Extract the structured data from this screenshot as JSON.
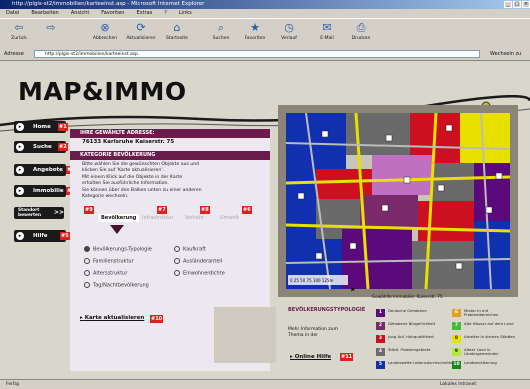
{
  "window": {
    "title": "http://plgis-st2/immobilien/karteeinst.asp - Microsoft Internet Explorer"
  },
  "menu": [
    "Datei",
    "Bearbeiten",
    "Ansicht",
    "Favoriten",
    "Extras",
    "?",
    "Links"
  ],
  "toolbar": [
    {
      "label": "Zurück",
      "icon": "back-icon"
    },
    {
      "label": "",
      "icon": "forward-icon"
    },
    {
      "label": "Abbrechen",
      "icon": "stop-icon"
    },
    {
      "label": "Aktualisieren",
      "icon": "refresh-icon"
    },
    {
      "label": "Startseite",
      "icon": "home-icon"
    },
    {
      "label": "Suchen",
      "icon": "search-icon"
    },
    {
      "label": "Favoriten",
      "icon": "favorites-icon"
    },
    {
      "label": "Verlauf",
      "icon": "history-icon"
    },
    {
      "label": "E-Mail",
      "icon": "mail-icon"
    },
    {
      "label": "Drucken",
      "icon": "print-icon"
    }
  ],
  "address": {
    "label": "Adresse",
    "url": "http://plgis-st2/immobilien/karteeinst.asp",
    "go": "Wechseln zu"
  },
  "logo": "MAP&IMMO",
  "nav": [
    {
      "label": "Home",
      "num": "#1"
    },
    {
      "label": "Suche",
      "num": "#2"
    },
    {
      "label": "Angebote",
      "num": "#3"
    },
    {
      "label": "Immobilie",
      "num": "#4"
    },
    {
      "label": "Standort bewerten",
      "num": "",
      "arrow": ">>"
    },
    {
      "label": "Hilfe",
      "num": "#5"
    }
  ],
  "address_section": {
    "heading": "IHRE GEWÄHLTE ADRESSE:",
    "value": "76133 Karlsruhe  Kaiserstr. 75"
  },
  "category_section": {
    "heading": "KATEGORIE BEVÖLKERUNG",
    "desc1": "Bitte wählen Sie die gewünschten Objekte aus und klicken Sie auf 'Karte aktualisieren'.",
    "desc2": "Mit einem Klick auf die Objekte in der Karte erhalten Sie ausführliche Information.",
    "desc3": "Sie können über den Balken unten zu einer anderen Kategorie wechseln.",
    "markers": [
      "#6",
      "#7",
      "#8",
      "#9"
    ]
  },
  "tabs": [
    "Bevölkerung",
    "Infrastruktur",
    "Verkehr",
    "Umwelt"
  ],
  "options": [
    {
      "label": "Bevölkerungs-Typologie",
      "checked": true
    },
    {
      "label": "Familienstruktur",
      "checked": false
    },
    {
      "label": "Altersstruktur",
      "checked": false
    },
    {
      "label": "Tag/Nachtbevölkerung",
      "checked": false
    },
    {
      "label": "Kaufkraft",
      "checked": false
    },
    {
      "label": "Ausländeranteil",
      "checked": false
    },
    {
      "label": "Einwohnerdichte",
      "checked": false
    }
  ],
  "update_map": {
    "label": "Karte aktualisieren",
    "num": "#10"
  },
  "map": {
    "scale": "0  25  50  75  100  125m",
    "location_caption": "Gewählte Immobilie: Kaiserstr. 75"
  },
  "legend": {
    "title": "BEVÖLKERUNGSTYPOLOGIE",
    "more_info": "Mehr Information zum Thema in der",
    "online_help": "Online Hilfe",
    "online_help_num": "#11",
    "items": [
      {
        "num": "1",
        "color": "#5a0a7a",
        "text": "Deutsche Gehobene"
      },
      {
        "num": "2",
        "color": "#7a2a6a",
        "text": "Gehobene Bürgerlichkeit"
      },
      {
        "num": "3",
        "color": "#cc1020",
        "text": "Jung Auf- Hohqualifiziert"
      },
      {
        "num": "4",
        "color": "#6a6a6a",
        "text": "Städt. Problemgebiete"
      },
      {
        "num": "5",
        "color": "#1030b0",
        "text": "Landesweite Lebensdurchschnitte"
      },
      {
        "num": "6",
        "color": "#e0a020",
        "text": "Mieter in mit Problembereichen"
      },
      {
        "num": "7",
        "color": "#40c030",
        "text": "Alte Häuser auf dem Land"
      },
      {
        "num": "8",
        "color": "#e8e000",
        "text": "Arbeiter in kleinen Städten"
      },
      {
        "num": "9",
        "color": "#b8e840",
        "text": "Alteer Land in Ländergemeinden"
      },
      {
        "num": "10",
        "color": "#1a8a1a",
        "text": "Landbevölkerung"
      }
    ]
  },
  "status": {
    "left": "Fertig",
    "right": "Lokales Intranet"
  },
  "colors": {
    "brand": "#6a1c4a",
    "accent": "#e02020",
    "titlebar": "#0a246a"
  }
}
